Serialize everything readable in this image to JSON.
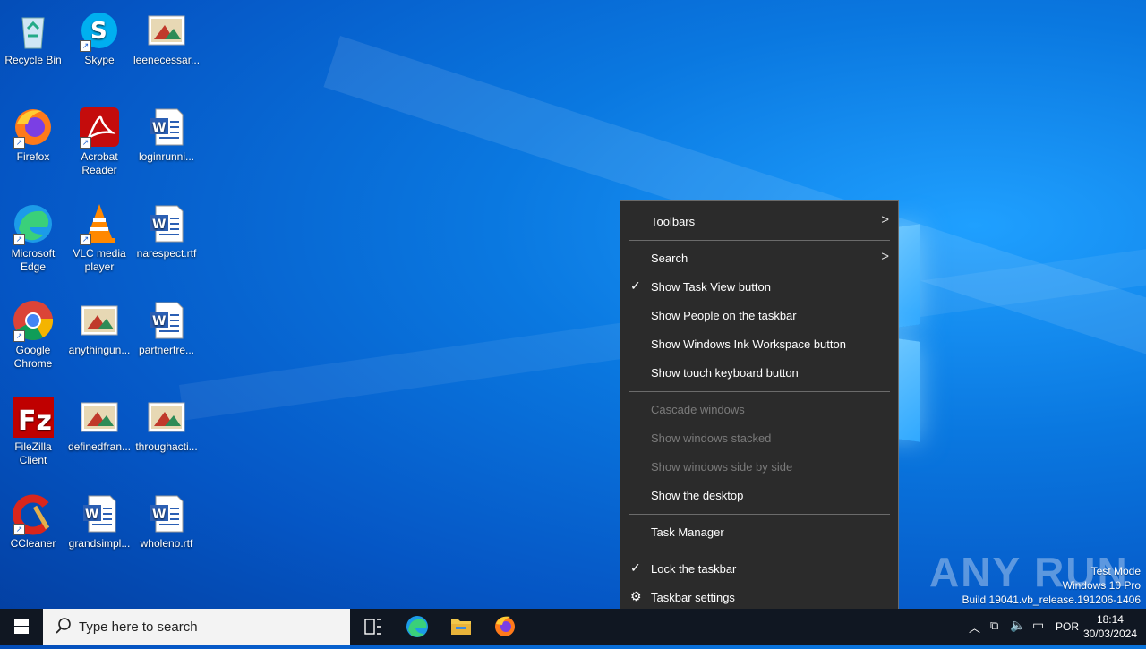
{
  "desktop": {
    "icons": [
      {
        "label": "Recycle Bin",
        "icon": "recycle-bin-icon"
      },
      {
        "label": "Skype",
        "icon": "skype-icon"
      },
      {
        "label": "leenecessar...",
        "icon": "image-file-icon"
      },
      {
        "label": "Firefox",
        "icon": "firefox-icon"
      },
      {
        "label": "Acrobat Reader",
        "icon": "acrobat-icon"
      },
      {
        "label": "loginrunni...",
        "icon": "word-doc-icon"
      },
      {
        "label": "Microsoft Edge",
        "icon": "edge-icon"
      },
      {
        "label": "VLC media player",
        "icon": "vlc-icon"
      },
      {
        "label": "narespect.rtf",
        "icon": "word-doc-icon"
      },
      {
        "label": "Google Chrome",
        "icon": "chrome-icon"
      },
      {
        "label": "anythingun...",
        "icon": "image-file-icon"
      },
      {
        "label": "partnertre...",
        "icon": "word-doc-icon"
      },
      {
        "label": "FileZilla Client",
        "icon": "filezilla-icon"
      },
      {
        "label": "definedfran...",
        "icon": "image-file-icon"
      },
      {
        "label": "throughacti...",
        "icon": "image-file-icon"
      },
      {
        "label": "CCleaner",
        "icon": "ccleaner-icon"
      },
      {
        "label": "grandsimpl...",
        "icon": "word-doc-icon"
      },
      {
        "label": "wholeno.rtf",
        "icon": "word-doc-icon"
      }
    ]
  },
  "context_menu": {
    "toolbars": "Toolbars",
    "search": "Search",
    "show_task_view": "Show Task View button",
    "show_people": "Show People on the taskbar",
    "show_ink": "Show Windows Ink Workspace button",
    "show_touch_keyboard": "Show touch keyboard button",
    "cascade": "Cascade windows",
    "stacked": "Show windows stacked",
    "side_by_side": "Show windows side by side",
    "show_desktop": "Show the desktop",
    "task_manager": "Task Manager",
    "lock_taskbar": "Lock the taskbar",
    "taskbar_settings": "Taskbar settings"
  },
  "taskbar": {
    "search_placeholder": "Type here to search",
    "language": "POR",
    "time": "18:14",
    "date": "30/03/2024"
  },
  "watermark": {
    "brand": "ANY RUN",
    "mode": "Test Mode",
    "edition": "Windows 10 Pro",
    "build": "Build 19041.vb_release.191206-1406"
  },
  "colors": {
    "menu_bg": "#2b2b2b",
    "taskbar_bg": "#101722",
    "desktop_blue": "#0a78e0"
  }
}
